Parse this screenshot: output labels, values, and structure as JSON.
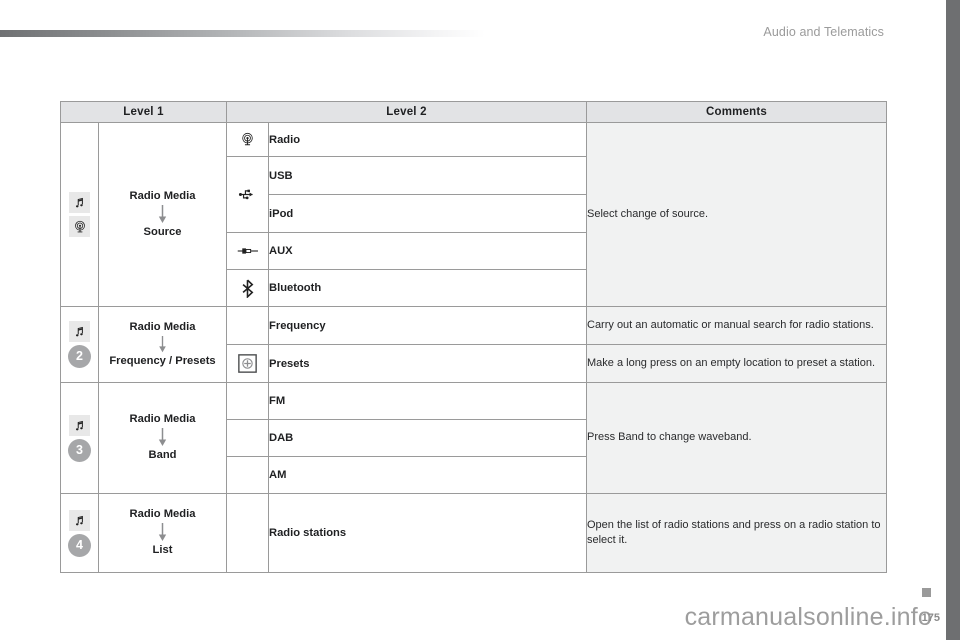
{
  "header": {
    "section_title": "Audio and Telematics"
  },
  "table": {
    "columns": [
      "Level 1",
      "Level 2",
      "Comments"
    ],
    "groups": [
      {
        "badge": {
          "icons": [
            "music-note-icon",
            "radio-antenna-icon"
          ],
          "number": null
        },
        "level1": {
          "top": "Radio Media",
          "arrow": "down-arrow-icon",
          "bottom": "Source"
        },
        "level2": [
          {
            "icon": "radio-antenna-icon",
            "label": "Radio"
          },
          {
            "icon": "usb-icon",
            "label": "USB"
          },
          {
            "icon": "usb-icon",
            "label": "iPod"
          },
          {
            "icon": "aux-jack-icon",
            "label": "AUX"
          },
          {
            "icon": "bluetooth-icon",
            "label": "Bluetooth"
          }
        ],
        "comments": [
          "Select change of source."
        ]
      },
      {
        "badge": {
          "icons": [
            "music-note-icon"
          ],
          "number": "2"
        },
        "level1": {
          "top": "Radio Media",
          "arrow": "down-arrow-icon",
          "bottom": "Frequency / Presets"
        },
        "level2": [
          {
            "icon": null,
            "label": "Frequency"
          },
          {
            "icon": "preset-add-icon",
            "label": "Presets"
          }
        ],
        "comments": [
          "Carry out an automatic or manual search for radio stations.",
          "Make a long press on an empty location to preset a station."
        ]
      },
      {
        "badge": {
          "icons": [
            "music-note-icon"
          ],
          "number": "3"
        },
        "level1": {
          "top": "Radio Media",
          "arrow": "down-arrow-icon",
          "bottom": "Band"
        },
        "level2": [
          {
            "icon": null,
            "label": "FM"
          },
          {
            "icon": null,
            "label": "DAB"
          },
          {
            "icon": null,
            "label": "AM"
          }
        ],
        "comments": [
          "Press Band to change waveband."
        ]
      },
      {
        "badge": {
          "icons": [
            "music-note-icon"
          ],
          "number": "4"
        },
        "level1": {
          "top": "Radio Media",
          "arrow": "down-arrow-icon",
          "bottom": "List"
        },
        "level2": [
          {
            "icon": null,
            "label": "Radio stations"
          }
        ],
        "comments": [
          "Open the list of radio stations and press on a radio station to select it."
        ]
      }
    ]
  },
  "footer": {
    "watermark": "carmanualsonline.info",
    "page_number": "175"
  }
}
